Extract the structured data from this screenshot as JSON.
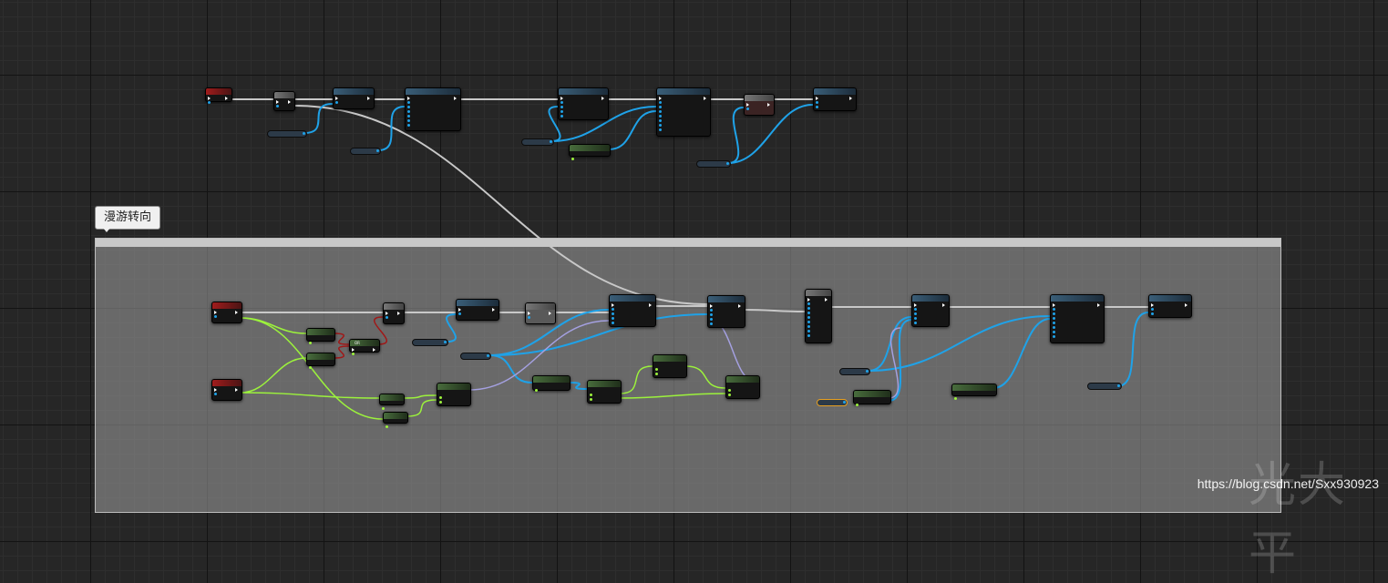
{
  "comment": {
    "bubble_text": "漫游转向",
    "bar_text": ""
  },
  "watermark": {
    "url_text": "https://blog.csdn.net/Sxx930923",
    "logo_text": "光大平"
  },
  "colors": {
    "exec_wire": "#c8c8c8",
    "object_wire": "#1fa2e8",
    "bool_wire": "#9cf23c",
    "red_wire": "#a01818",
    "struct_wire": "#a4a0e0",
    "background": "#262626",
    "comment_fill": "#969696"
  },
  "icons": {
    "exec_pin": "triangle-icon",
    "data_pin": "circle-icon"
  },
  "nodes": [
    {
      "id": "event-begin-play",
      "kind": "event",
      "title": ""
    },
    {
      "id": "do-once",
      "kind": "macro",
      "title": ""
    },
    {
      "id": "delay-top",
      "kind": "function",
      "title": ""
    },
    {
      "id": "func-a-top",
      "kind": "function",
      "title": ""
    },
    {
      "id": "func-b-top",
      "kind": "function",
      "title": ""
    },
    {
      "id": "set-view-target-top",
      "kind": "function",
      "title": ""
    },
    {
      "id": "red-macro-top",
      "kind": "macro",
      "title": ""
    },
    {
      "id": "play-top",
      "kind": "function",
      "title": ""
    },
    {
      "id": "get-player-controller-top",
      "kind": "pure",
      "title": ""
    },
    {
      "id": "input-event-1",
      "kind": "event",
      "title": ""
    },
    {
      "id": "input-event-2",
      "kind": "event",
      "title": ""
    },
    {
      "id": "compare-1",
      "kind": "pure",
      "title": ""
    },
    {
      "id": "compare-2",
      "kind": "pure",
      "title": ""
    },
    {
      "id": "or-node",
      "kind": "pure",
      "title": "OR"
    },
    {
      "id": "branch-node",
      "kind": "macro",
      "title": ""
    },
    {
      "id": "delay-mid",
      "kind": "function",
      "title": ""
    },
    {
      "id": "grey-macro-mid",
      "kind": "macro",
      "title": ""
    },
    {
      "id": "func-a-mid",
      "kind": "function",
      "title": ""
    },
    {
      "id": "func-b-mid",
      "kind": "function",
      "title": ""
    },
    {
      "id": "and-1",
      "kind": "pure",
      "title": ""
    },
    {
      "id": "and-2",
      "kind": "pure",
      "title": ""
    },
    {
      "id": "make-vector-1",
      "kind": "pure",
      "title": ""
    },
    {
      "id": "get-actor-mid",
      "kind": "pure",
      "title": ""
    },
    {
      "id": "vector-mid",
      "kind": "pure",
      "title": ""
    },
    {
      "id": "break-mid",
      "kind": "pure",
      "title": ""
    },
    {
      "id": "make-vector-2",
      "kind": "pure",
      "title": ""
    },
    {
      "id": "switch-node",
      "kind": "macro",
      "title": ""
    },
    {
      "id": "func-c-bottom",
      "kind": "function",
      "title": ""
    },
    {
      "id": "get-actor-bottom",
      "kind": "pure",
      "title": ""
    },
    {
      "id": "set-view-target-bottom",
      "kind": "function",
      "title": ""
    },
    {
      "id": "get-player-controller-bottom",
      "kind": "pure",
      "title": ""
    },
    {
      "id": "play-bottom",
      "kind": "function",
      "title": ""
    }
  ]
}
